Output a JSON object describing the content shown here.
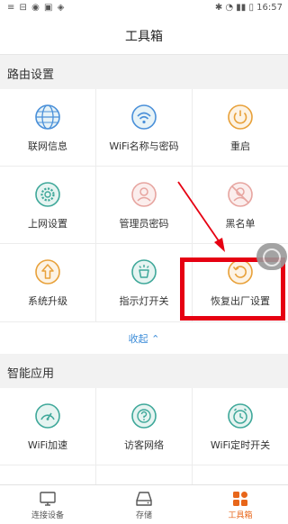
{
  "status_bar": {
    "left_icons": "≡ ⊟ ◉ ▣ ◈",
    "right_text": "✱ ◔ ▮▮ ▯ 16:57"
  },
  "header": {
    "title": "工具箱"
  },
  "sections": [
    {
      "title": "路由设置",
      "items": [
        {
          "label": "联网信息",
          "icon": "globe-icon"
        },
        {
          "label": "WiFi名称与密码",
          "icon": "wifi-icon"
        },
        {
          "label": "重启",
          "icon": "power-icon"
        },
        {
          "label": "上网设置",
          "icon": "gear-icon"
        },
        {
          "label": "管理员密码",
          "icon": "user-icon"
        },
        {
          "label": "黑名单",
          "icon": "blocked-user-icon"
        },
        {
          "label": "系统升级",
          "icon": "upgrade-icon"
        },
        {
          "label": "指示灯开关",
          "icon": "lamp-icon"
        },
        {
          "label": "恢复出厂设置",
          "icon": "reset-icon"
        }
      ],
      "collapse_label": "收起 ⌃"
    },
    {
      "title": "智能应用",
      "items": [
        {
          "label": "WiFi加速",
          "icon": "speedometer-icon"
        },
        {
          "label": "访客网络",
          "icon": "guest-network-icon"
        },
        {
          "label": "WiFi定时开关",
          "icon": "alarm-clock-icon"
        }
      ]
    }
  ],
  "tabs": [
    {
      "label": "连接设备",
      "icon": "monitor-icon",
      "active": false
    },
    {
      "label": "存储",
      "icon": "storage-icon",
      "active": false
    },
    {
      "label": "工具箱",
      "icon": "toolbox-icon",
      "active": true
    }
  ],
  "colors": {
    "icon_teal": "#3fa89a",
    "icon_blue": "#4a90d9",
    "icon_orange": "#e8a13a",
    "icon_pink": "#e7a5a0",
    "highlight_red": "#e60012",
    "accent_link": "#3a8bd8",
    "tab_active": "#e8661a"
  }
}
